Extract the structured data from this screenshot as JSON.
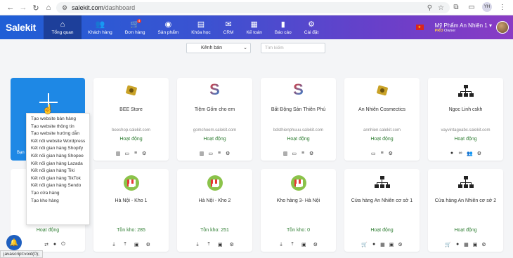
{
  "browser": {
    "url_host": "salekit.com",
    "url_path": "/dashboard",
    "profile": "YH"
  },
  "header": {
    "logo": "Salekit",
    "nav": [
      {
        "label": "Tổng quan",
        "icon": "home-icon",
        "active": true
      },
      {
        "label": "Khách hàng",
        "icon": "users-icon",
        "active": false
      },
      {
        "label": "Đơn hàng",
        "icon": "cart-icon",
        "active": false,
        "badge": "4"
      },
      {
        "label": "Sản phẩm",
        "icon": "product-icon",
        "active": false
      },
      {
        "label": "Khóa học",
        "icon": "book-icon",
        "active": false
      },
      {
        "label": "CRM",
        "icon": "mail-icon",
        "active": false
      },
      {
        "label": "Kế toán",
        "icon": "accounting-icon",
        "active": false
      },
      {
        "label": "Báo cáo",
        "icon": "chart-icon",
        "active": false
      },
      {
        "label": "Cài đặt",
        "icon": "gear-icon",
        "active": false
      }
    ],
    "shop_name": "Mỹ Phẩm An Nhiên 1",
    "plan_label": "PRO",
    "plan_role": "Owner"
  },
  "filters": {
    "channel_select": "Kênh bán",
    "search_placeholder": "Tìm kiếm"
  },
  "add_card": {
    "label": "Bạn"
  },
  "dropdown": {
    "items": [
      "Tạo website bán hàng",
      "Tạo website thông tin",
      "Tạo website hướng dẫn",
      "Kết nối website Wordpress",
      "Kết nối gian hàng Shopify",
      "Kết nối gian hàng Shopee",
      "Kết nối gian hàng Lazada",
      "Kết nối gian hàng Tiki",
      "Kết nối gian hàng TikTok",
      "Kết nối gian hàng Sendo",
      "Tạo cửa hàng",
      "Tạo kho hàng"
    ]
  },
  "cards_row1": [
    {
      "title": "BEE Store",
      "url": "beeshop.salekit.com",
      "status": "Hoạt động"
    },
    {
      "title": "Tiệm Gốm cho em",
      "url": "gomchoem.salekit.com",
      "status": "Hoạt động"
    },
    {
      "title": "Bất Động Sản Thiên Phú",
      "url": "bdsthienphuuu.salekit.com",
      "status": "Hoạt động"
    },
    {
      "title": "An Nhiên Cosmectics",
      "url": "annhien.salekit.com",
      "status": "Hoạt động"
    },
    {
      "title": "Ngoc Linh cskh",
      "url": "vayvintageabc.salekit.com",
      "status": "Hoạt động"
    }
  ],
  "cards_row2": [
    {
      "title": "Hà Nội - Kho 1",
      "status": "Tồn kho: 285"
    },
    {
      "title": "Hà Nội - Kho 2",
      "status": "Tồn kho: 251"
    },
    {
      "title": "Kho hàng 3- Hà Nội",
      "status": "Tồn kho: 0"
    },
    {
      "title": "Cửa hàng An Nhiên cơ sở 1",
      "status": "Hoạt động"
    },
    {
      "title": "Cửa hàng An Nhiên cơ sở 2",
      "status": "Hoạt động"
    }
  ],
  "hidden_card_status": "Hoạt động",
  "status_bar": "javascript:void(0);"
}
